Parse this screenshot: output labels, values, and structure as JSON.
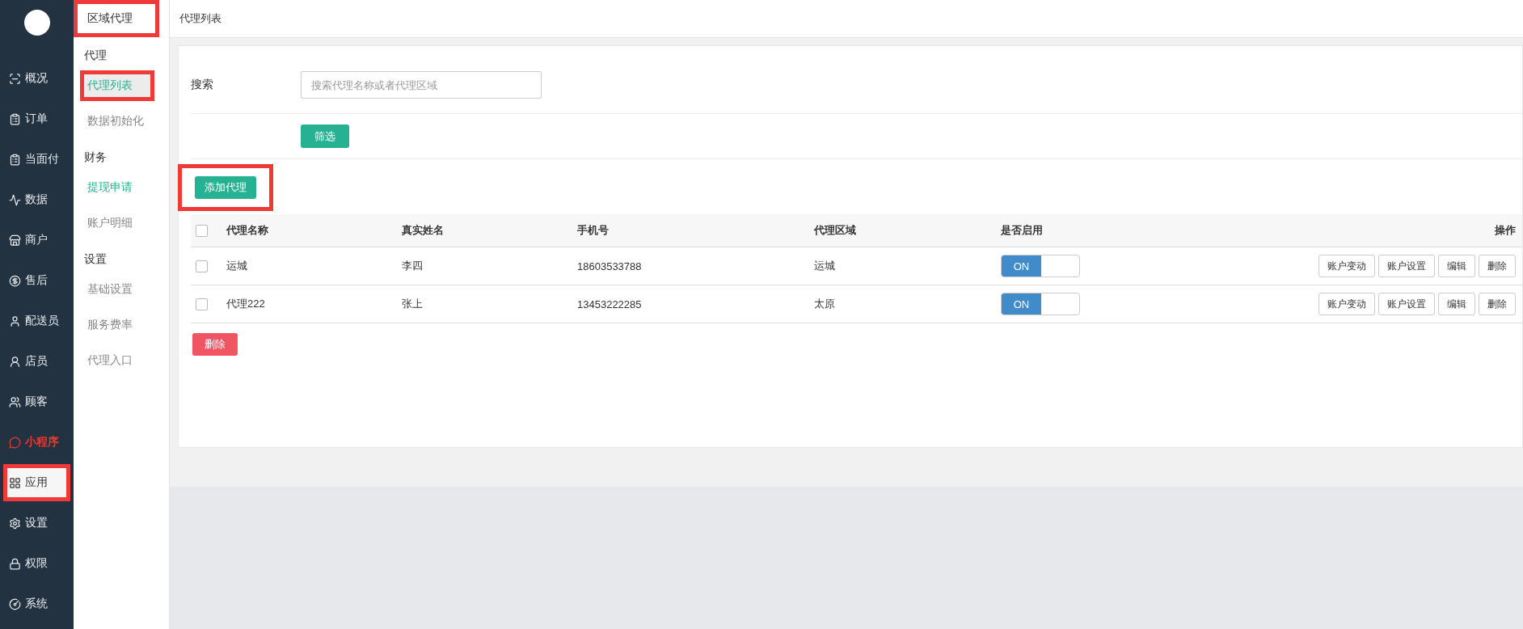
{
  "main_nav": {
    "items": [
      {
        "label": "概况",
        "selected": false,
        "color": "#e6eaee",
        "highlighted": false
      },
      {
        "label": "订单",
        "selected": false,
        "color": "#e6eaee",
        "highlighted": false
      },
      {
        "label": "当面付",
        "selected": false,
        "color": "#e6eaee",
        "highlighted": false
      },
      {
        "label": "数据",
        "selected": false,
        "color": "#e6eaee",
        "highlighted": false
      },
      {
        "label": "商户",
        "selected": false,
        "color": "#e6eaee",
        "highlighted": false
      },
      {
        "label": "售后",
        "selected": false,
        "color": "#e6eaee",
        "highlighted": false
      },
      {
        "label": "配送员",
        "selected": false,
        "color": "#e6eaee",
        "highlighted": false
      },
      {
        "label": "店员",
        "selected": false,
        "color": "#e6eaee",
        "highlighted": false
      },
      {
        "label": "顾客",
        "selected": false,
        "color": "#e6eaee",
        "highlighted": false
      },
      {
        "label": "小程序",
        "selected": false,
        "color": "#e8392f",
        "highlighted": false
      },
      {
        "label": "应用",
        "selected": true,
        "color": "#333333",
        "highlighted": true
      },
      {
        "label": "设置",
        "selected": false,
        "color": "#e6eaee",
        "highlighted": false
      },
      {
        "label": "权限",
        "selected": false,
        "color": "#e6eaee",
        "highlighted": false
      },
      {
        "label": "系统",
        "selected": false,
        "color": "#e6eaee",
        "highlighted": false
      }
    ]
  },
  "sub_nav": {
    "title": "区域代理",
    "highlighted": true,
    "sections": [
      {
        "heading": "代理",
        "items": [
          {
            "label": "代理列表",
            "selected": true,
            "color": "#27b193",
            "highlighted": true
          },
          {
            "label": "数据初始化",
            "selected": false,
            "color": "#888888",
            "highlighted": false
          }
        ]
      },
      {
        "heading": "财务",
        "items": [
          {
            "label": "提现申请",
            "selected": false,
            "color": "#27b193",
            "highlighted": false
          },
          {
            "label": "账户明细",
            "selected": false,
            "color": "#888888",
            "highlighted": false
          }
        ]
      },
      {
        "heading": "设置",
        "items": [
          {
            "label": "基础设置",
            "selected": false,
            "color": "#888888",
            "highlighted": false
          },
          {
            "label": "服务费率",
            "selected": false,
            "color": "#888888",
            "highlighted": false
          },
          {
            "label": "代理入口",
            "selected": false,
            "color": "#888888",
            "highlighted": false
          }
        ]
      }
    ]
  },
  "page_title": "代理列表",
  "filter": {
    "label": "搜索",
    "placeholder": "搜索代理名称或者代理区域",
    "button": "筛选"
  },
  "add_button": {
    "label": "添加代理",
    "highlighted": true
  },
  "table": {
    "header_checked": false,
    "columns": [
      "代理名称",
      "真实姓名",
      "手机号",
      "代理区域",
      "是否启用",
      "操作"
    ],
    "rows": [
      {
        "checked": false,
        "cells": [
          "运城",
          "李四",
          "18603533788",
          "运城"
        ],
        "enabled": {
          "on": true,
          "label": "ON"
        },
        "actions": [
          "账户变动",
          "账户设置",
          "编辑",
          "删除"
        ]
      },
      {
        "checked": false,
        "cells": [
          "代理222",
          "张上",
          "13453222285",
          "太原"
        ],
        "enabled": {
          "on": true,
          "label": "ON"
        },
        "actions": [
          "账户变动",
          "账户设置",
          "编辑",
          "删除"
        ]
      }
    ]
  },
  "delete_button": "删除"
}
